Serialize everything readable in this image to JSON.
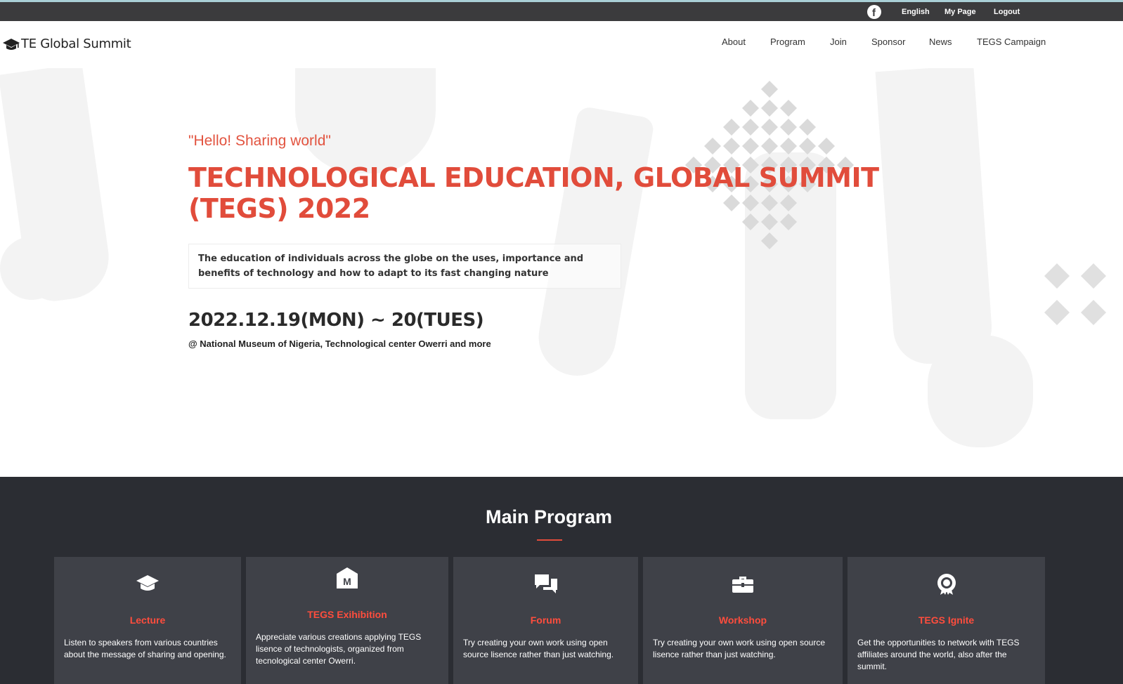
{
  "topbar": {
    "facebook_icon": "facebook-icon",
    "language": "English",
    "my_page": "My Page",
    "logout": "Logout"
  },
  "header": {
    "logo_icon": "graduation-cap-icon",
    "logo_text": "TE Global Summit",
    "nav": [
      "About",
      "Program",
      "Join",
      "Sponsor",
      "News",
      "TEGS Campaign"
    ]
  },
  "hero": {
    "greeting": "\"Hello! Sharing world\"",
    "title": "TECHNOLOGICAL EDUCATION, GLOBAL SUMMIT (TEGS) 2022",
    "description": "The education of individuals across the globe on the uses, importance and benefits of technology and how to adapt to its fast changing nature",
    "dates": "2022.12.19(MON) ~ 20(TUES)",
    "venue": "@ National Museum of Nigeria, Technological center Owerri and more"
  },
  "program": {
    "title": "Main Program",
    "cards": [
      {
        "icon": "graduation-cap-icon",
        "name": "Lecture",
        "description": "Listen to speakers from various countries about the message of sharing and opening."
      },
      {
        "icon": "museum-icon",
        "name": "TEGS Exihibition",
        "description": "Appreciate various creations applying TEGS lisence of technologists, organized from tecnological center Owerri."
      },
      {
        "icon": "chat-bubbles-icon",
        "name": "Forum",
        "description": "Try creating your own work using open source lisence rather than just watching."
      },
      {
        "icon": "briefcase-icon",
        "name": "Workshop",
        "description": "Try creating your own work using open source lisence rather than just watching."
      },
      {
        "icon": "award-icon",
        "name": "TEGS Ignite",
        "description": "Get the opportunities to network with TEGS affiliates around the world, also after the summit."
      }
    ]
  },
  "colors": {
    "accent": "#e14c3b",
    "topbar": "#3b3b3d",
    "program_bg": "#2b2d33",
    "card_bg": "#3f4148"
  }
}
